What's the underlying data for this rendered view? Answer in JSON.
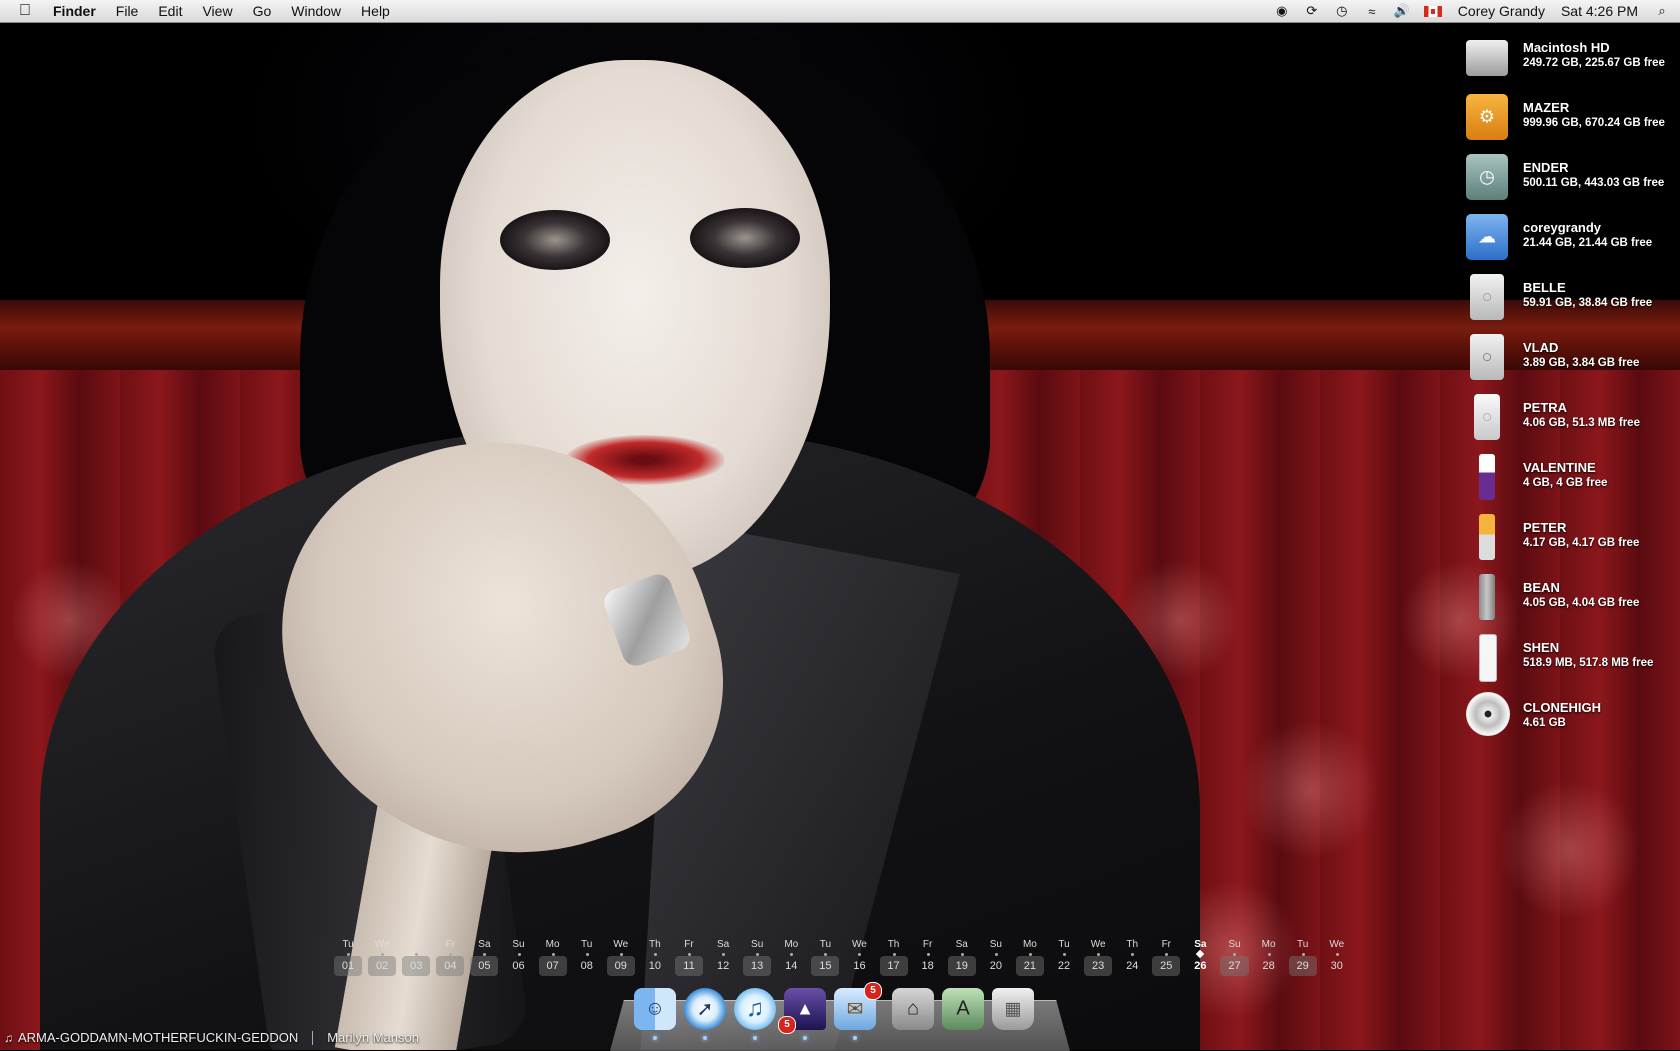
{
  "menubar": {
    "app": "Finder",
    "menus": [
      "File",
      "Edit",
      "View",
      "Go",
      "Window",
      "Help"
    ],
    "user": "Corey Grandy",
    "clock": "Sat 4:26 PM",
    "status_icons": [
      "record-icon",
      "sync-icon",
      "time-machine-icon",
      "wifi-icon",
      "volume-icon",
      "flag-icon",
      "spotlight-icon"
    ]
  },
  "volumes": [
    {
      "name": "Macintosh HD",
      "info": "249.72 GB, 225.67 GB free",
      "icon": "hard-drive-icon"
    },
    {
      "name": "MAZER",
      "info": "999.96 GB, 670.24 GB free",
      "icon": "usb-drive-icon"
    },
    {
      "name": "ENDER",
      "info": "500.11 GB, 443.03 GB free",
      "icon": "time-machine-drive-icon"
    },
    {
      "name": "coreygrandy",
      "info": "21.44 GB, 21.44 GB free",
      "icon": "idisk-icon"
    },
    {
      "name": "BELLE",
      "info": "59.91 GB, 38.84 GB free",
      "icon": "ipod-classic-icon"
    },
    {
      "name": "VLAD",
      "info": "3.89 GB, 3.84 GB free",
      "icon": "ipod-video-icon"
    },
    {
      "name": "PETRA",
      "info": "4.06 GB, 51.3 MB free",
      "icon": "ipod-mini-icon"
    },
    {
      "name": "VALENTINE",
      "info": "4 GB, 4 GB free",
      "icon": "usb-stick-icon"
    },
    {
      "name": "PETER",
      "info": "4.17 GB, 4.17 GB free",
      "icon": "usb-stick-icon"
    },
    {
      "name": "BEAN",
      "info": "4.05 GB, 4.04 GB free",
      "icon": "ipod-shuffle-icon"
    },
    {
      "name": "SHEN",
      "info": "518.9 MB, 517.8 MB free",
      "icon": "ipod-shuffle-icon"
    },
    {
      "name": "CLONEHIGH",
      "info": "4.61 GB",
      "icon": "dvd-icon"
    }
  ],
  "calendar": {
    "today": "26",
    "days": [
      {
        "wd": "Tu",
        "d": "01"
      },
      {
        "wd": "We",
        "d": "02"
      },
      {
        "wd": "Th",
        "d": "03"
      },
      {
        "wd": "Fr",
        "d": "04"
      },
      {
        "wd": "Sa",
        "d": "05"
      },
      {
        "wd": "Su",
        "d": "06"
      },
      {
        "wd": "Mo",
        "d": "07"
      },
      {
        "wd": "Tu",
        "d": "08"
      },
      {
        "wd": "We",
        "d": "09"
      },
      {
        "wd": "Th",
        "d": "10"
      },
      {
        "wd": "Fr",
        "d": "11"
      },
      {
        "wd": "Sa",
        "d": "12"
      },
      {
        "wd": "Su",
        "d": "13"
      },
      {
        "wd": "Mo",
        "d": "14"
      },
      {
        "wd": "Tu",
        "d": "15"
      },
      {
        "wd": "We",
        "d": "16"
      },
      {
        "wd": "Th",
        "d": "17"
      },
      {
        "wd": "Fr",
        "d": "18"
      },
      {
        "wd": "Sa",
        "d": "19"
      },
      {
        "wd": "Su",
        "d": "20"
      },
      {
        "wd": "Mo",
        "d": "21"
      },
      {
        "wd": "Tu",
        "d": "22"
      },
      {
        "wd": "We",
        "d": "23"
      },
      {
        "wd": "Th",
        "d": "24"
      },
      {
        "wd": "Fr",
        "d": "25"
      },
      {
        "wd": "Sa",
        "d": "26"
      },
      {
        "wd": "Su",
        "d": "27"
      },
      {
        "wd": "Mo",
        "d": "28"
      },
      {
        "wd": "Tu",
        "d": "29"
      },
      {
        "wd": "We",
        "d": "30"
      }
    ]
  },
  "dock": [
    {
      "app": "finder",
      "icon": "finder-icon",
      "running": true
    },
    {
      "app": "safari",
      "icon": "safari-icon",
      "running": true
    },
    {
      "app": "itunes",
      "icon": "itunes-icon",
      "running": true
    },
    {
      "app": "growl",
      "icon": "growl-icon",
      "running": true,
      "badge": "5"
    },
    {
      "app": "mail",
      "icon": "mail-icon",
      "running": true,
      "badge": "5"
    },
    {
      "app": "home",
      "icon": "home-folder-icon",
      "running": false
    },
    {
      "app": "applications",
      "icon": "applications-folder-icon",
      "running": false
    },
    {
      "app": "trash",
      "icon": "trash-icon",
      "running": false
    }
  ],
  "now_playing": {
    "track": "ARMA-GODDAMN-MOTHERFUCKIN-GEDDON",
    "artist": "Marilyn Manson"
  }
}
